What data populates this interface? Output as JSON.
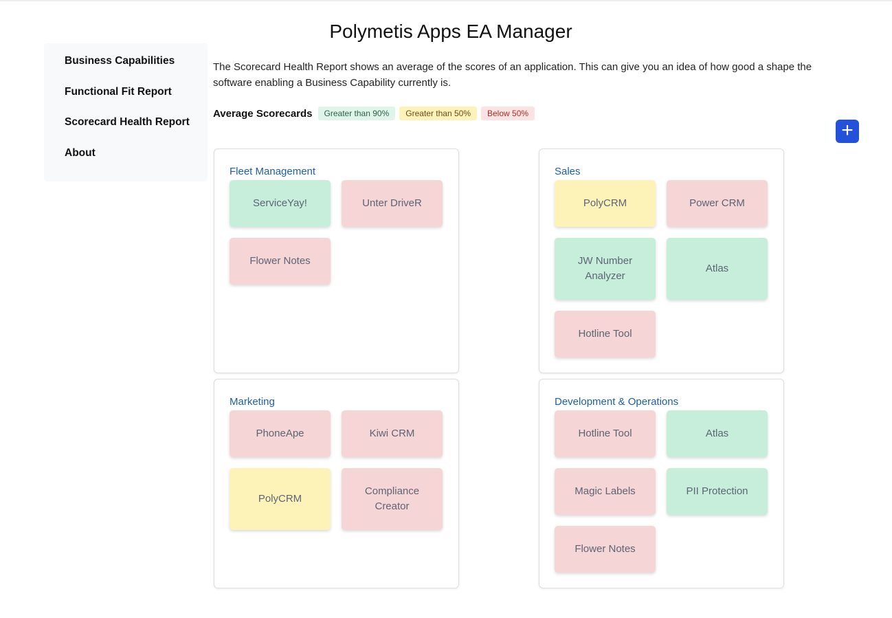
{
  "title": "Polymetis Apps EA Manager",
  "sidebar": {
    "items": [
      {
        "label": "Business Capabilities"
      },
      {
        "label": "Functional Fit Report"
      },
      {
        "label": "Scorecard Health Report"
      },
      {
        "label": "About"
      }
    ]
  },
  "description": "The Scorecard Health Report shows an average of the scores of an application. This can give you an idea of how good a shape the software enabling a Business Capability currently is.",
  "legend": {
    "label": "Average Scorecards",
    "high": "Greater than 90%",
    "mid": "Greater than 50%",
    "low": "Below 50%"
  },
  "colors": {
    "high": "#c6eedb",
    "mid": "#fdf3b9",
    "low": "#f5d5d5",
    "accent": "#2352d8"
  },
  "add_label": "+",
  "capabilities": [
    {
      "name": "Fleet Management",
      "apps": [
        {
          "name": "ServiceYay!",
          "level": "high"
        },
        {
          "name": "Unter DriveR",
          "level": "low"
        },
        {
          "name": "Flower Notes",
          "level": "low"
        }
      ]
    },
    {
      "name": "Sales",
      "apps": [
        {
          "name": "PolyCRM",
          "level": "mid"
        },
        {
          "name": "Power CRM",
          "level": "low"
        },
        {
          "name": "JW Number Analyzer",
          "level": "high"
        },
        {
          "name": "Atlas",
          "level": "high"
        },
        {
          "name": "Hotline Tool",
          "level": "low"
        }
      ]
    },
    {
      "name": "Marketing",
      "apps": [
        {
          "name": "PhoneApe",
          "level": "low"
        },
        {
          "name": "Kiwi CRM",
          "level": "low"
        },
        {
          "name": "PolyCRM",
          "level": "mid"
        },
        {
          "name": "Compliance Creator",
          "level": "low"
        }
      ]
    },
    {
      "name": "Development & Operations",
      "apps": [
        {
          "name": "Hotline Tool",
          "level": "low"
        },
        {
          "name": "Atlas",
          "level": "high"
        },
        {
          "name": "Magic Labels",
          "level": "low"
        },
        {
          "name": "PII Protection",
          "level": "high"
        },
        {
          "name": "Flower Notes",
          "level": "low"
        }
      ]
    }
  ]
}
